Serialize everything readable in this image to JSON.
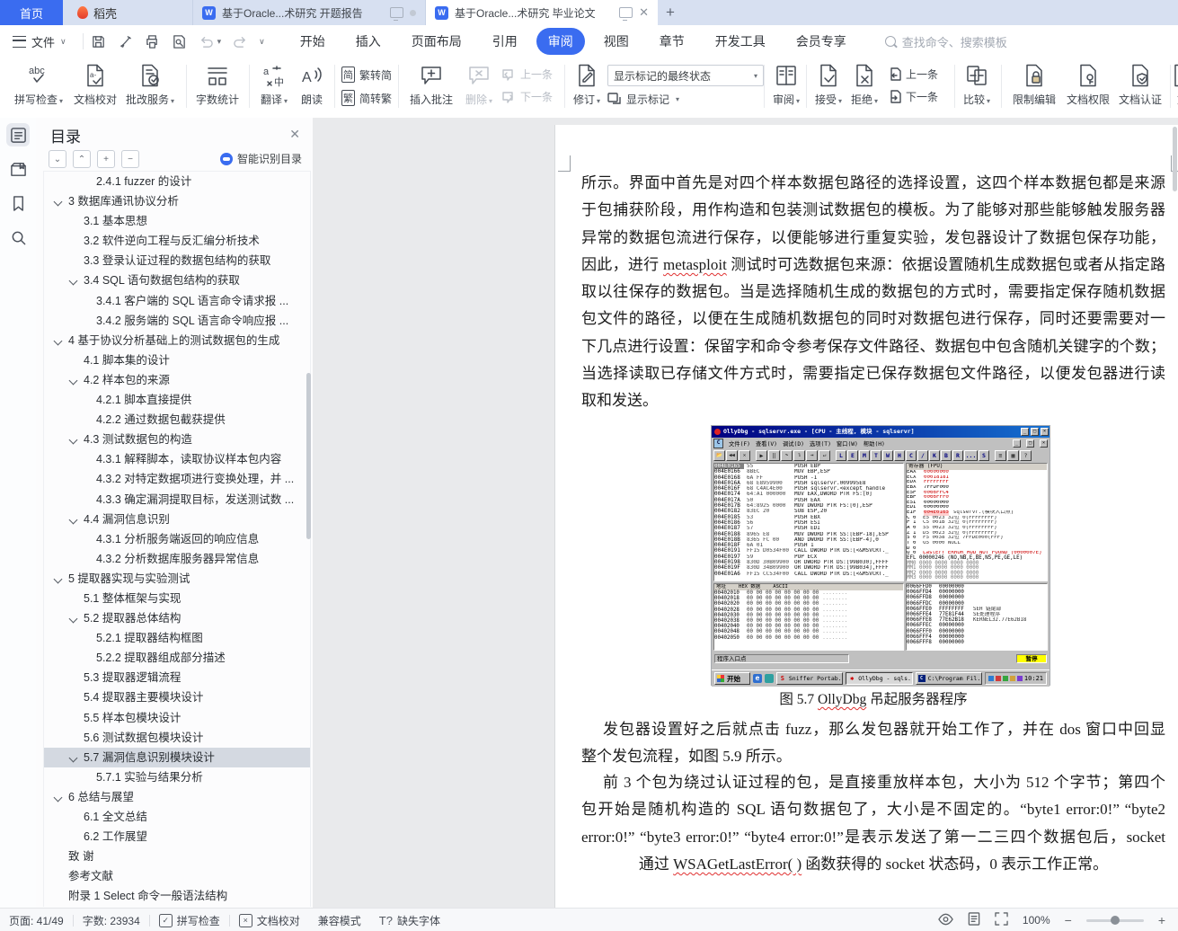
{
  "tabbar": {
    "home": "首页",
    "docer": "稻壳",
    "doc_tabs": [
      {
        "title": "基于Oracle...术研究 开题报告",
        "active": false
      },
      {
        "title": "基于Oracle...术研究 毕业论文",
        "active": true
      }
    ]
  },
  "menubar": {
    "file_label": "文件",
    "tabs": [
      "开始",
      "插入",
      "页面布局",
      "引用",
      "审阅",
      "视图",
      "章节",
      "开发工具",
      "会员专享"
    ],
    "active_tab": "审阅",
    "search_placeholder": "查找命令、搜索模板"
  },
  "ribbon": {
    "spell_check": "拼写检查",
    "doc_proof": "文档校对",
    "correction_service": "批改服务",
    "word_count": "字数统计",
    "translate": "翻译",
    "read_aloud": "朗读",
    "trad_to_simp": "繁转简",
    "simp_to_trad": "简转繁",
    "insert_comment": "插入批注",
    "delete_comment": "删除",
    "prev_comment": "上一条",
    "next_comment": "下一条",
    "track_changes": "修订",
    "markup_state": "显示标记的最终状态",
    "show_markup": "显示标记",
    "review": "审阅",
    "accept": "接受",
    "reject": "拒绝",
    "prev_change": "上一条",
    "next_change": "下一条",
    "compare": "比较",
    "restrict_edit": "限制编辑",
    "doc_permission": "文档权限",
    "doc_certify": "文档认证",
    "partial_right": "文"
  },
  "toc": {
    "title": "目录",
    "smart_toc": "智能识别目录",
    "items": [
      {
        "text": "2.4.1 fuzzer 的设计",
        "level": 3
      },
      {
        "text": "3 数据库通讯协议分析",
        "level": 1,
        "arrow": true
      },
      {
        "text": "3.1 基本思想",
        "level": 2
      },
      {
        "text": "3.2 软件逆向工程与反汇编分析技术",
        "level": 2
      },
      {
        "text": "3.3 登录认证过程的数据包结构的获取",
        "level": 2
      },
      {
        "text": "3.4 SQL 语句数据包结构的获取",
        "level": 2,
        "arrow": true
      },
      {
        "text": "3.4.1 客户端的 SQL 语言命令请求报 ...",
        "level": 3
      },
      {
        "text": "3.4.2 服务端的 SQL 语言命令响应报 ...",
        "level": 3
      },
      {
        "text": "4 基于协议分析基础上的测试数据包的生成",
        "level": 1,
        "arrow": true
      },
      {
        "text": "4.1 脚本集的设计",
        "level": 2
      },
      {
        "text": "4.2 样本包的来源",
        "level": 2,
        "arrow": true
      },
      {
        "text": "4.2.1 脚本直接提供",
        "level": 3
      },
      {
        "text": "4.2.2 通过数据包截获提供",
        "level": 3
      },
      {
        "text": "4.3 测试数据包的构造",
        "level": 2,
        "arrow": true
      },
      {
        "text": "4.3.1 解释脚本，读取协议样本包内容",
        "level": 3
      },
      {
        "text": "4.3.2 对特定数据项进行变换处理，并 ...",
        "level": 3
      },
      {
        "text": "4.3.3 确定漏洞提取目标，发送测试数 ...",
        "level": 3
      },
      {
        "text": "4.4 漏洞信息识别",
        "level": 2,
        "arrow": true
      },
      {
        "text": "4.3.1 分析服务端返回的响应信息",
        "level": 3
      },
      {
        "text": "4.3.2 分析数据库服务器异常信息",
        "level": 3
      },
      {
        "text": "5 提取器实现与实验测试",
        "level": 1,
        "arrow": true
      },
      {
        "text": "5.1 整体框架与实现",
        "level": 2
      },
      {
        "text": "5.2 提取器总体结构",
        "level": 2,
        "arrow": true
      },
      {
        "text": "5.2.1 提取器结构框图",
        "level": 3
      },
      {
        "text": "5.2.2 提取器组成部分描述",
        "level": 3
      },
      {
        "text": "5.3 提取器逻辑流程",
        "level": 2
      },
      {
        "text": "5.4 提取器主要模块设计",
        "level": 2
      },
      {
        "text": "5.5 样本包模块设计",
        "level": 2
      },
      {
        "text": "5.6 测试数据包模块设计",
        "level": 2
      },
      {
        "text": "5.7 漏洞信息识别模块设计",
        "level": 2,
        "arrow": true,
        "selected": true
      },
      {
        "text": "5.7.1 实验与结果分析",
        "level": 3
      },
      {
        "text": "6 总结与展望",
        "level": 1,
        "arrow": true
      },
      {
        "text": "6.1 全文总结",
        "level": 2
      },
      {
        "text": "6.2 工作展望",
        "level": 2
      },
      {
        "text": "致 谢",
        "level": 1
      },
      {
        "text": "参考文献",
        "level": 1
      },
      {
        "text": "附录 1 Select 命令一般语法结构",
        "level": 1
      }
    ]
  },
  "document": {
    "para1": [
      [
        "所示。界面中首先是对四个样本数据包路径的选择设置，这四个样本数据包都是来源"
      ],
      [
        "于包捕获阶段，用作构造和包装测试数据包的模板。为了能够对那些能够触发服务器"
      ],
      [
        "异常的数据包流进行保存，以便能够进行重复实验，发包器设计了数据包保存功能，"
      ],
      [
        "因此，进行 ",
        {
          "w": "metasploit"
        },
        " 测试时可选数据包来源：依据设置随机生成数据包或者从指定路径读"
      ],
      [
        "取以往保存的数据包。当是选择随机生成的数据包的方式时，需要指定保存随机数据"
      ],
      [
        "包文件的路径，以便在生成随机数据包的同时对数据包进行保存，同时还要需要对一"
      ],
      [
        "下几点进行设置：保留字和命令参考保存文件路径、数据包中包含随机关键字的个数；"
      ],
      [
        "当选择读取已存储文件方式时，需要指定已保存数据包文件路径，以便发包器进行读"
      ],
      [
        "取和发送。"
      ]
    ],
    "caption": [
      "图 5.7 ",
      {
        "w": "OllyDbg"
      },
      " 吊起服务器程序"
    ],
    "para2": [
      [
        "发包器设置好之后就点击 fuzz，那么发包器就开始工作了，并在 dos 窗口中回显"
      ],
      [
        "整个发包流程，如图 5.9 所示。"
      ]
    ],
    "para3": [
      [
        "前 3 个包为绕过认证过程的包，是直接重放样本包，大小为 512 个字节；第四个"
      ],
      [
        "包开始是随机构造的 SQL 语句数据包了，大小是不固定的。“byte1 error:0!” “byte2"
      ],
      [
        "error:0!” “byte3 error:0!” “byte4 error:0!”是表示发送了第一二三四个数据包后，socket"
      ],
      [
        "通过 ",
        {
          "w": "WSAGetLastError( )"
        },
        " 函数获得的 socket 状态码，0 表示工作正常。"
      ]
    ],
    "figure": {
      "title": "OllyDbg - sqlservr.exe - [CPU - 主线程, 模块 - sqlservr]",
      "menu": [
        "文件(F)",
        "查看(V)",
        "调试(D)",
        "选项(T)",
        "窗口(W)",
        "帮助(H)"
      ],
      "toolbar_letters": [
        "L",
        "E",
        "M",
        "T",
        "W",
        "H",
        "C",
        "/",
        "K",
        "B",
        "R",
        "...",
        "S"
      ],
      "disasm": [
        [
          "004E0165",
          "55",
          "PUSH EBP"
        ],
        [
          "004E0166",
          "8BEC",
          "MOV EBP,ESP"
        ],
        [
          "004E0168",
          "6A FF",
          "PUSH -1"
        ],
        [
          "004E016A",
          "68 E8959900",
          "PUSH sqlservr.009995E8"
        ],
        [
          "004E016F",
          "68 C4AC4E00",
          "PUSH sqlservr.<except_handle"
        ],
        [
          "004E0174",
          "64:A1 000000",
          "MOV EAX,DWORD PTR FS:[0]"
        ],
        [
          "004E017A",
          "50",
          "PUSH EAX"
        ],
        [
          "004E017B",
          "64:8925 0000",
          "MOV DWORD PTR FS:[0],ESP"
        ],
        [
          "004E0182",
          "83EC 20",
          "SUB ESP,20"
        ],
        [
          "004E0185",
          "53",
          "PUSH EBX"
        ],
        [
          "004E0186",
          "56",
          "PUSH ESI"
        ],
        [
          "004E0187",
          "57",
          "PUSH EDI"
        ],
        [
          "004E0188",
          "8965 E8",
          "MOV DWORD PTR SS:[EBP-18],ESP"
        ],
        [
          "004E018B",
          "8365 FC 00",
          "AND DWORD PTR SS:[EBP-4],0"
        ],
        [
          "004E018F",
          "6A 01",
          "PUSH 1"
        ],
        [
          "004E0191",
          "FF15 D0534F00",
          "CALL DWORD PTR DS:[<&MSVCRT._"
        ],
        [
          "004E0197",
          "59",
          "POP ECX"
        ],
        [
          "004E0198",
          "830D 30B09900",
          "OR DWORD PTR DS:[99B030],FFFF"
        ],
        [
          "004E019F",
          "830D 34B09900",
          "OR DWORD PTR DS:[99B034],FFFF"
        ],
        [
          "004E01A6",
          "FF15 CC534F00",
          "CALL DWORD PTR DS:[<&MSVCRT._"
        ]
      ],
      "reg_pane_title": "寄存器 (FPU)",
      "registers": [
        [
          "EAX",
          "00000000",
          1
        ],
        [
          "ECX",
          "00018181",
          1
        ],
        [
          "EDX",
          "FFFFFFFF",
          1
        ],
        [
          "EBX",
          "7FFDF000",
          0
        ],
        [
          "ESP",
          "0066FFC4",
          1
        ],
        [
          "EBP",
          "0066FFF0",
          1
        ],
        [
          "ESI",
          "00000000",
          0
        ],
        [
          "EDI",
          "00000000",
          0
        ]
      ],
      "eip": [
        "EIP",
        "004E0165",
        "sqlservr.(模块入口点)"
      ],
      "flags": [
        [
          "C 0",
          "ES 0023 32位 0(FFFFFFFF)"
        ],
        [
          "P 1",
          "CS 001B 32位 0(FFFFFFFF)"
        ],
        [
          "A 0",
          "SS 0023 32位 0(FFFFFFFF)"
        ],
        [
          "Z 1",
          "DS 0023 32位 0(FFFFFFFF)"
        ],
        [
          "S 0",
          "FS 0038 32位 7FFDE000(FFF)"
        ],
        [
          "T 0",
          "GS 0000 NULL"
        ],
        [
          "D 0",
          ""
        ],
        [
          "O 0",
          "LastErr ERROR_MOD_NOT_FOUND (0000007E)"
        ]
      ],
      "efl": "EFL 00000246 (NO,NB,E,BE,NS,PE,GE,LE)",
      "mm": [
        "MM0 0000 0000 0000 0000",
        "MM1 0000 0000 0000 0000",
        "MM2 0000 0000 0000 0000",
        "MM3 0000 0000 0000 0000"
      ],
      "hex_header": [
        "地址",
        "HEX 数据",
        "ASCII"
      ],
      "hex_rows": [
        "00402010",
        "00402018",
        "00402020",
        "00402028",
        "00402030",
        "00402038",
        "00402040",
        "00402048",
        "00402050"
      ],
      "hex_bytes": "00 00 00 00 00 00 00 00",
      "hex_ascii": "........",
      "stack": [
        [
          "0066FFD0",
          "00000000",
          ""
        ],
        [
          "0066FFD4",
          "00000000",
          ""
        ],
        [
          "0066FFD8",
          "00000000",
          ""
        ],
        [
          "0066FFDC",
          "00000000",
          ""
        ],
        [
          "0066FFE0",
          "FFFFFFFF",
          "SEH 链尾部"
        ],
        [
          "0066FFE4",
          "77E81F44",
          "SE处理程序"
        ],
        [
          "0066FFE8",
          "77E62B18",
          "KERNEL32.77E62B18"
        ],
        [
          "0066FFEC",
          "00000000",
          ""
        ],
        [
          "0066FFF0",
          "00000000",
          ""
        ],
        [
          "0066FFF4",
          "00000000",
          ""
        ],
        [
          "0066FFF8",
          "00000000",
          ""
        ]
      ],
      "status_left": "程序入口点",
      "status_right": "暂停",
      "taskbar": {
        "start": "开始",
        "tasks": [
          "Sniffer Portab...",
          "OllyDbg - sqls...",
          "C:\\Program Fil..."
        ],
        "time": "10:21"
      }
    }
  },
  "statusbar": {
    "page": "页面: 41/49",
    "words": "字数: 23934",
    "spell": "拼写检查",
    "proof": "文档校对",
    "compat": "兼容模式",
    "missing_font": "缺失字体",
    "zoom": "100%"
  }
}
